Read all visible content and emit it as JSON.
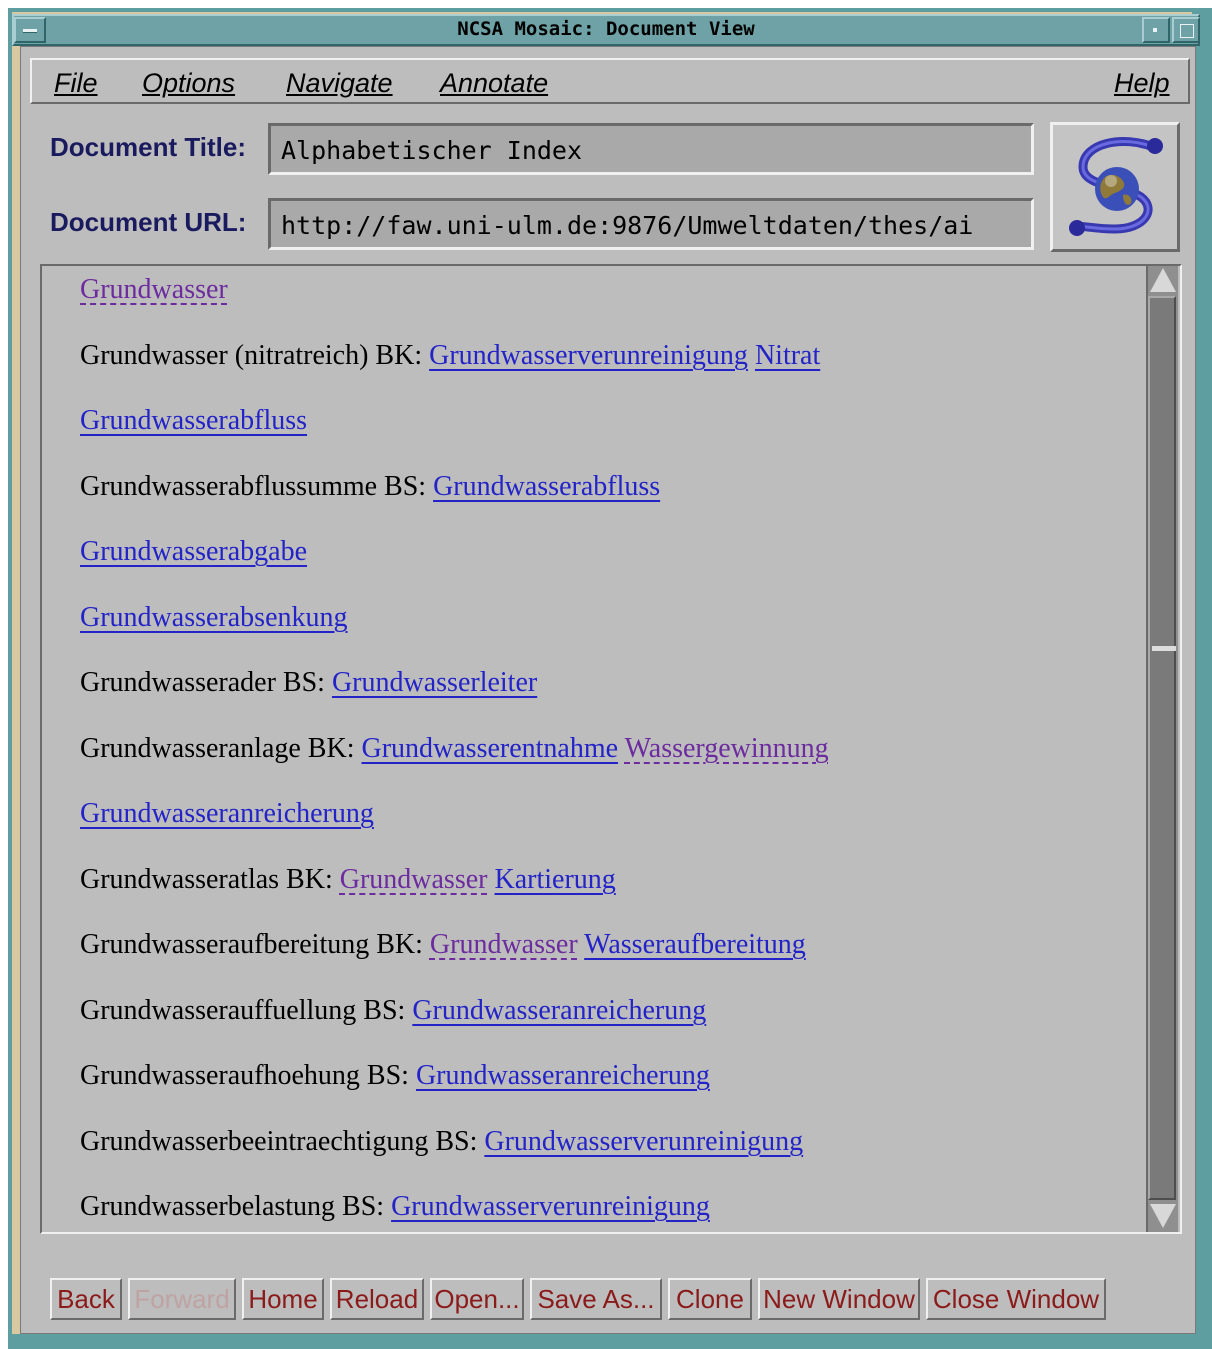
{
  "window": {
    "title": "NCSA Mosaic: Document View"
  },
  "menubar": {
    "file": "File",
    "options": "Options",
    "navigate": "Navigate",
    "annotate": "Annotate",
    "help": "Help"
  },
  "fields": {
    "title_label": "Document Title:",
    "title_value": "Alphabetischer Index",
    "url_label": "Document URL:",
    "url_value": "http://faw.uni-ulm.de:9876/Umweltdaten/thes/ai"
  },
  "entries": [
    {
      "prefix": "",
      "links": [
        {
          "text": "Grundwasser",
          "visited": true
        }
      ]
    },
    {
      "prefix": "Grundwasser (nitratreich) BK: ",
      "links": [
        {
          "text": "Grundwasserverunreinigung",
          "visited": false
        },
        {
          "text": "Nitrat",
          "visited": false
        }
      ]
    },
    {
      "prefix": "",
      "links": [
        {
          "text": "Grundwasserabfluss",
          "visited": false
        }
      ]
    },
    {
      "prefix": "Grundwasserabflussumme BS: ",
      "links": [
        {
          "text": "Grundwasserabfluss",
          "visited": false
        }
      ]
    },
    {
      "prefix": "",
      "links": [
        {
          "text": "Grundwasserabgabe",
          "visited": false
        }
      ]
    },
    {
      "prefix": "",
      "links": [
        {
          "text": "Grundwasserabsenkung",
          "visited": false
        }
      ]
    },
    {
      "prefix": "Grundwasserader BS: ",
      "links": [
        {
          "text": "Grundwasserleiter",
          "visited": false
        }
      ]
    },
    {
      "prefix": "Grundwasseranlage BK: ",
      "links": [
        {
          "text": "Grundwasserentnahme",
          "visited": false
        },
        {
          "text": "Wassergewinnung",
          "visited": true
        }
      ]
    },
    {
      "prefix": "",
      "links": [
        {
          "text": "Grundwasseranreicherung",
          "visited": false
        }
      ]
    },
    {
      "prefix": "Grundwasseratlas BK: ",
      "links": [
        {
          "text": "Grundwasser",
          "visited": true
        },
        {
          "text": "Kartierung",
          "visited": false
        }
      ]
    },
    {
      "prefix": "Grundwasseraufbereitung BK: ",
      "links": [
        {
          "text": "Grundwasser",
          "visited": true
        },
        {
          "text": "Wasseraufbereitung",
          "visited": false
        }
      ]
    },
    {
      "prefix": "Grundwasserauffuellung BS: ",
      "links": [
        {
          "text": "Grundwasseranreicherung",
          "visited": false
        }
      ]
    },
    {
      "prefix": "Grundwasseraufhoehung BS: ",
      "links": [
        {
          "text": "Grundwasseranreicherung",
          "visited": false
        }
      ]
    },
    {
      "prefix": "Grundwasserbeeintraechtigung BS: ",
      "links": [
        {
          "text": "Grundwasserverunreinigung",
          "visited": false
        }
      ]
    },
    {
      "prefix": "Grundwasserbelastung BS: ",
      "links": [
        {
          "text": "Grundwasserverunreinigung",
          "visited": false
        }
      ]
    }
  ],
  "buttons": {
    "back": "Back",
    "forward": "Forward",
    "home": "Home",
    "reload": "Reload",
    "open": "Open...",
    "save_as": "Save As...",
    "clone": "Clone",
    "new_window": "New Window",
    "close_window": "Close Window"
  },
  "colors": {
    "link": "#2323c8",
    "visited_link": "#6c2b9e",
    "button_text": "#8b1a1a",
    "frame": "#5f9ea0"
  },
  "icons": {
    "logo": "mosaic-globe-logo-icon",
    "scroll_up": "scroll-up-arrow-icon",
    "scroll_down": "scroll-down-arrow-icon"
  }
}
